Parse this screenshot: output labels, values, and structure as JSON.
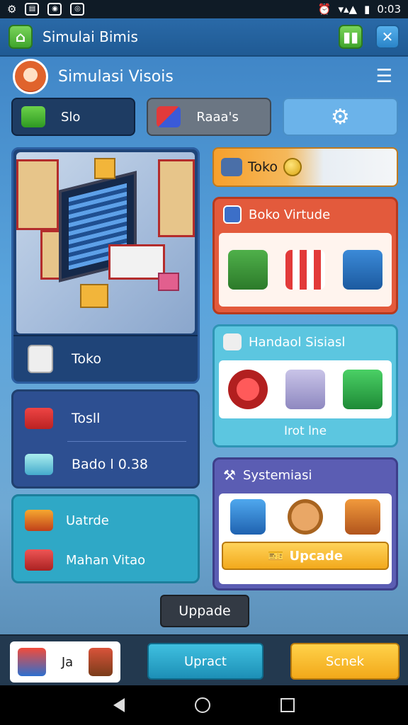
{
  "status_bar": {
    "time": "0:03"
  },
  "app_bar": {
    "title": "Simulai Bimis"
  },
  "profile": {
    "name": "Simulasi Visois"
  },
  "tabs": [
    {
      "label": "Slo"
    },
    {
      "label": "Raaa's"
    },
    {
      "label": ""
    }
  ],
  "left": {
    "hero_label": "Toko",
    "card1": {
      "row1": "Tosll",
      "row2": "Bado l 0.38"
    },
    "card2": {
      "row1": "Uatrde",
      "row2": "Mahan Vitao"
    }
  },
  "right": {
    "toko_bar": "Toko",
    "panel1_title": "Boko Virtude",
    "panel2_title": "Handaol Sisiasl",
    "panel2_footer": "Irot lne",
    "panel3_title": "Systemiasi",
    "panel3_button": "Upcade"
  },
  "center_button": "Uppade",
  "bottom": {
    "inv_label": "Ja",
    "teal_button": "Upract",
    "yellow_button": "Scnek"
  },
  "colors": {
    "primary": "#2a6aa8",
    "accent_yellow": "#f2a91c",
    "accent_teal": "#2fa8c6"
  }
}
